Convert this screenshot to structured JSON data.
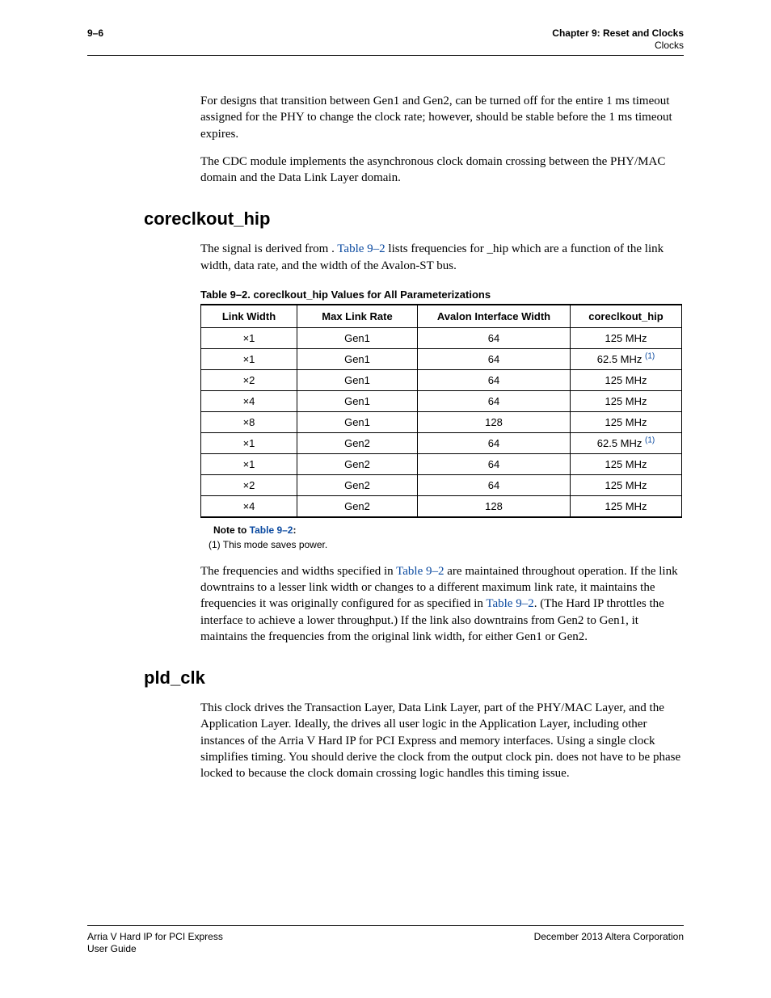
{
  "header": {
    "page_num": "9–6",
    "chapter": "Chapter 9:  Reset and Clocks",
    "subhead": "Clocks"
  },
  "p1_a": "For designs that transition between Gen1 and Gen2, ",
  "p1_b": " can be turned off for the entire 1 ms timeout assigned for the PHY to change the clock rate; however, ",
  "p1_c": " should be stable before the 1 ms timeout expires.",
  "p2_a": "The CDC module implements the asynchronous clock domain crossing between the PHY/MAC ",
  "p2_b": " domain and the Data Link Layer ",
  "p2_c": " domain.",
  "h_coreclkout": "coreclkout_hip",
  "p3_a": "The ",
  "p3_b": " signal is derived from ",
  "p3_c": ". ",
  "p3_link": "Table 9–2",
  "p3_d": " lists frequencies for ",
  "p3_e": "_hip which are a function of the link width, data rate, and the width of the Avalon-ST bus.",
  "table_caption_a": "Table 9–2.",
  "table_caption_b": "   coreclkout_hip Values for All Parameterizations",
  "tbl": {
    "headers": [
      "Link Width",
      "Max Link Rate",
      "Avalon Interface Width",
      "coreclkout_hip"
    ],
    "rows": [
      {
        "c0": "×1",
        "c1": "Gen1",
        "c2": "64",
        "c3": "125 MHz",
        "note": false
      },
      {
        "c0": "×1",
        "c1": "Gen1",
        "c2": "64",
        "c3": "62.5 MHz ",
        "note": true
      },
      {
        "c0": "×2",
        "c1": "Gen1",
        "c2": "64",
        "c3": "125 MHz",
        "note": false
      },
      {
        "c0": "×4",
        "c1": "Gen1",
        "c2": "64",
        "c3": "125 MHz",
        "note": false
      },
      {
        "c0": "×8",
        "c1": "Gen1",
        "c2": "128",
        "c3": "125 MHz",
        "note": false
      },
      {
        "c0": "×1",
        "c1": "Gen2",
        "c2": "64",
        "c3": "62.5 MHz ",
        "note": true
      },
      {
        "c0": "×1",
        "c1": "Gen2",
        "c2": "64",
        "c3": "125 MHz",
        "note": false
      },
      {
        "c0": "×2",
        "c1": "Gen2",
        "c2": "64",
        "c3": "125 MHz",
        "note": false
      },
      {
        "c0": "×4",
        "c1": "Gen2",
        "c2": "128",
        "c3": "125 MHz",
        "note": false
      }
    ]
  },
  "note_label_a": "Note to ",
  "note_label_link": "Table 9–2",
  "note_label_b": ":",
  "note1": "(1)   This mode saves power.",
  "footnote_sup": "(1)",
  "p4_a": "The frequencies and widths specified in ",
  "p4_link1": "Table 9–2",
  "p4_b": " are maintained throughout operation. If the link downtrains to a lesser link width or changes to a different maximum link rate, it maintains the frequencies it was originally configured for as specified in ",
  "p4_link2": "Table 9–2",
  "p4_c": ". (The Hard IP throttles the interface to achieve a lower throughput.) If the link also downtrains from Gen2 to Gen1, it maintains the frequencies from the original link width, for either Gen1 or Gen2.",
  "h_pldclk": "pld_clk",
  "p5_a": "This clock drives the Transaction Layer, Data Link Layer, part of the PHY/MAC Layer, and the Application Layer. Ideally, the ",
  "p5_b": " drives all user logic in the Application Layer, including other instances of the Arria  V Hard IP for PCI Express and memory interfaces. Using a single clock simplifies timing. You should derive the ",
  "p5_c": " clock from the ",
  "p5_d": " output clock pin. ",
  "p5_e": " does not have to be phase locked to ",
  "p5_f": " because the clock domain crossing logic handles this timing issue.",
  "footer": {
    "left1": "Arria V Hard IP for PCI Express",
    "left2": "User Guide",
    "right": "December 2013   Altera Corporation"
  }
}
